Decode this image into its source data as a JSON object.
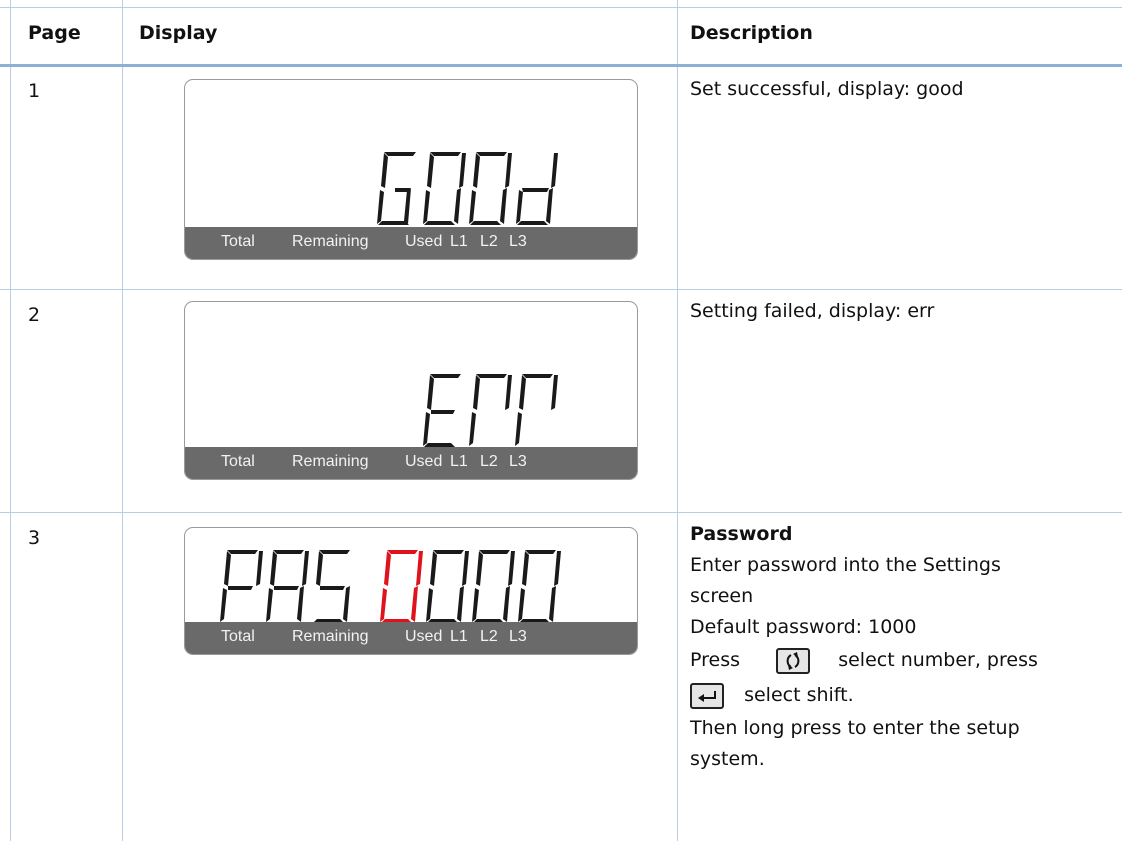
{
  "table": {
    "headers": {
      "page": "Page",
      "display": "Display",
      "description": "Description"
    },
    "rows": [
      {
        "page": "1",
        "lcd_text": "G00d",
        "description": "Set successful, display: good"
      },
      {
        "page": "2",
        "lcd_text": "Err",
        "description": "Setting failed, display: err"
      },
      {
        "page": "3",
        "lcd_text": "PAS 0000",
        "description_title": "Password",
        "description_lines": [
          "Enter password into the Settings",
          "screen",
          "Default password: 1000"
        ],
        "press_1": "Press",
        "press_1_rest": "select number, press",
        "press_2_rest": "select shift.",
        "final_lines": [
          "Then long press to enter the setup",
          "system."
        ]
      }
    ]
  },
  "lcd_labels": {
    "total": "Total",
    "remaining": "Remaining",
    "used": "Used",
    "l1": "L1",
    "l2": "L2",
    "l3": "L3"
  },
  "colors": {
    "segment": "#1a1a1a",
    "highlight_segment": "#e0121c",
    "bar": "#6a6a6a",
    "rule": "#b9cde4"
  },
  "icons": {
    "key_1": "rotate-key-icon",
    "key_2": "enter-key-icon"
  }
}
